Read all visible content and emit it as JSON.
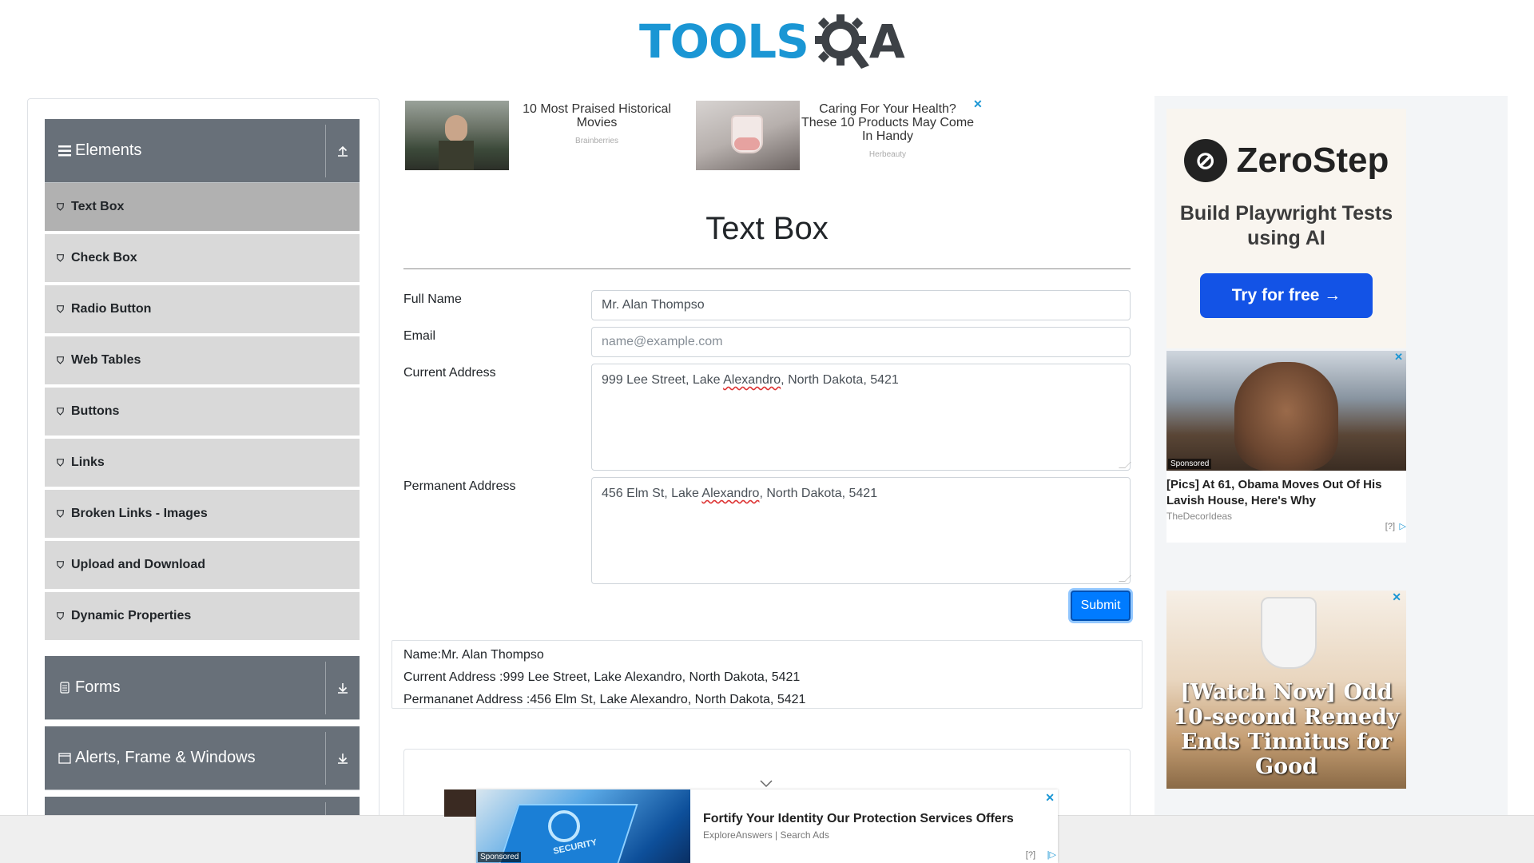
{
  "logo": {
    "text_left": "TOOLS",
    "text_right": "A",
    "brand_color": "#1a96d4"
  },
  "sidebar": {
    "groups": [
      {
        "label": "Elements",
        "icon": "hamburger-icon",
        "arrow": "collapse-arrow-icon"
      },
      {
        "label": "Forms",
        "icon": "document-icon",
        "arrow": "expand-arrow-icon"
      },
      {
        "label": "Alerts, Frame & Windows",
        "icon": "window-icon",
        "arrow": "expand-arrow-icon"
      }
    ],
    "items": [
      {
        "label": "Text Box",
        "active": true
      },
      {
        "label": "Check Box"
      },
      {
        "label": "Radio Button"
      },
      {
        "label": "Web Tables"
      },
      {
        "label": "Buttons"
      },
      {
        "label": "Links"
      },
      {
        "label": "Broken Links - Images"
      },
      {
        "label": "Upload and Download"
      },
      {
        "label": "Dynamic Properties"
      }
    ]
  },
  "top_ads": [
    {
      "title": "10 Most Praised Historical Movies",
      "source": "Brainberries"
    },
    {
      "title": "Caring For Your Health? These 10 Products May Come In Handy",
      "source": "Herbeauty"
    }
  ],
  "main": {
    "title": "Text Box",
    "form": {
      "full_name_label": "Full Name",
      "full_name_value": "Mr. Alan Thompso",
      "email_label": "Email",
      "email_placeholder": "name@example.com",
      "current_address_label": "Current Address",
      "current_address_value": {
        "before": "999 Lee Street, Lake ",
        "underlined": "Alexandro",
        "after": ", North Dakota, 5421"
      },
      "permanent_address_label": "Permanent Address",
      "permanent_address_value": {
        "before": "456 Elm St, Lake ",
        "underlined": "Alexandro",
        "after": ", North Dakota, 5421"
      },
      "submit_label": "Submit"
    },
    "output": {
      "name": "Name:Mr. Alan Thompso",
      "current_address": "Current Address :999 Lee Street, Lake Alexandro, North Dakota, 5421",
      "permanent_address": "Permananet Address :456 Elm St, Lake Alexandro, North Dakota, 5421"
    }
  },
  "right_ads": {
    "zerostep": {
      "brand": "ZeroStep",
      "tagline": "Build Playwright Tests using AI",
      "cta": "Try for free →"
    },
    "obama": {
      "sponsored": "Sponsored",
      "title": "[Pics] At 61, Obama Moves Out Of His Lavish House, Here's Why",
      "source": "TheDecorIdeas",
      "adchoice": "[?]"
    },
    "remedy": {
      "text": "[Watch Now] Odd 10-second Remedy Ends Tinnitus for Good"
    }
  },
  "bottom_ad": {
    "sponsored": "Sponsored",
    "image_text": "SECURITY",
    "title": "Fortify Your Identity Our Protection Services Offers",
    "source": "ExploreAnswers | Search Ads",
    "adchoice": "[?]"
  }
}
